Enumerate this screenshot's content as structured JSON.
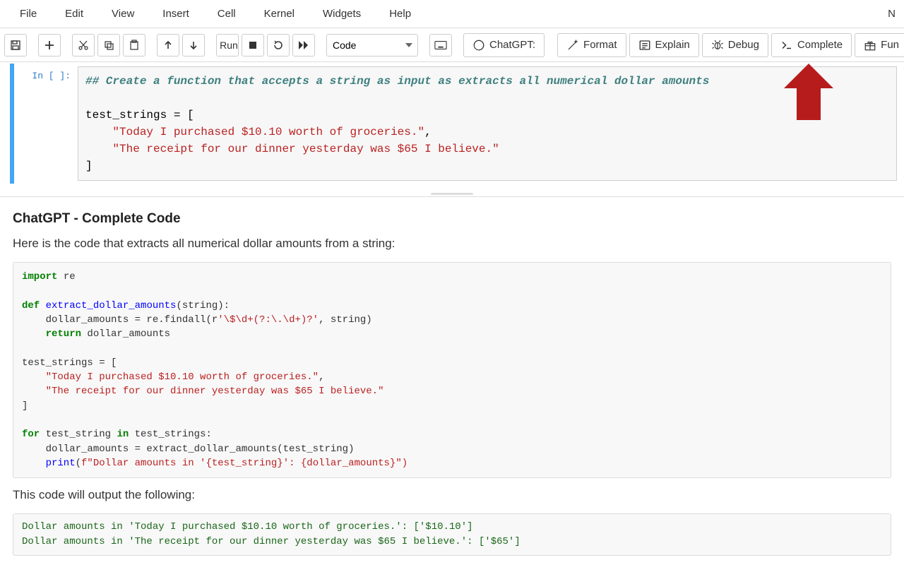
{
  "menu": {
    "items": [
      "File",
      "Edit",
      "View",
      "Insert",
      "Cell",
      "Kernel",
      "Widgets",
      "Help"
    ],
    "right_letter": "N"
  },
  "toolbar": {
    "run_label": "Run",
    "celltype_selected": "Code",
    "chatgpt_label": "ChatGPT:",
    "format_label": "Format",
    "explain_label": "Explain",
    "debug_label": "Debug",
    "complete_label": "Complete",
    "fun_label": "Fun"
  },
  "cell": {
    "prompt": "In [ ]:",
    "code": {
      "comment": "## Create a function that accepts a string as input as extracts all numerical dollar amounts",
      "line2_var": "test_strings",
      "line2_eq": " = [",
      "line3_str": "\"Today I purchased $10.10 worth of groceries.\"",
      "line3_comma": ",",
      "line4_str": "\"The receipt for our dinner yesterday was $65 I believe.\"",
      "line5": "]"
    }
  },
  "output": {
    "heading": "ChatGPT - Complete Code",
    "intro": "Here is the code that extracts all numerical dollar amounts from a string:",
    "code_lines": {
      "l1_kw": "import",
      "l1_mod": " re",
      "l3_kw": "def",
      "l3_fn": " extract_dollar_amounts",
      "l3_rest": "(string):",
      "l4": "    dollar_amounts = re.findall(r",
      "l4_str": "'\\$\\d+(?:\\.\\d+)?'",
      "l4_rest": ", string)",
      "l5_kw": "    return",
      "l5_rest": " dollar_amounts",
      "l7": "test_strings = [",
      "l8_str": "    \"Today I purchased $10.10 worth of groceries.\"",
      "l8_comma": ",",
      "l9_str": "    \"The receipt for our dinner yesterday was $65 I believe.\"",
      "l10": "]",
      "l12_kw": "for",
      "l12_mid": " test_string ",
      "l12_kw2": "in",
      "l12_rest": " test_strings:",
      "l13": "    dollar_amounts = extract_dollar_amounts(test_string)",
      "l14_fn": "    print",
      "l14_open": "(",
      "l14_pfx": "f\"Dollar amounts in '",
      "l14_mid": "{test_string}",
      "l14_mid2": "': ",
      "l14_mid3": "{dollar_amounts}",
      "l14_end": "\")"
    },
    "outro": "This code will output the following:",
    "result_lines": [
      "Dollar amounts in 'Today I purchased $10.10 worth of groceries.': ['$10.10']",
      "Dollar amounts in 'The receipt for our dinner yesterday was $65 I believe.': ['$65']"
    ]
  }
}
